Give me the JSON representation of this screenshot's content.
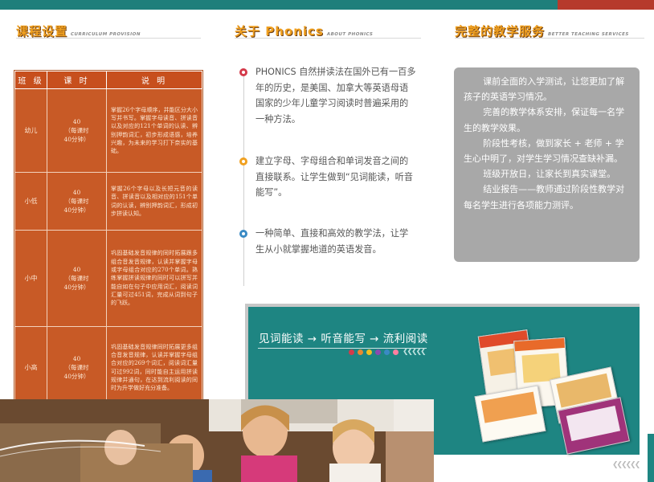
{
  "sections": {
    "curriculum": {
      "title": "课程设置",
      "subtitle": "CURRICULUM PROVISION"
    },
    "about": {
      "title": "关于 Phonics",
      "subtitle": "ABOUT PHONICS"
    },
    "service": {
      "title": "完整的教学服务",
      "subtitle": "BETTER TEACHING SERVICES"
    }
  },
  "table": {
    "headers": [
      "班 级",
      "课 时",
      "说 明"
    ],
    "rows": [
      {
        "grade": "幼儿",
        "hours": [
          "40",
          "（每课时",
          "40分钟）"
        ],
        "desc": "掌握26个字母顺序，并能区分大小写并书写。掌握字母读音、拼读音以及对应的121个单词的认读、辨别押韵词汇，初步形成语感，培养兴趣，为未来的学习打下奈实的基础。"
      },
      {
        "grade": "小低",
        "hours": [
          "40",
          "（每课时",
          "40分钟）"
        ],
        "desc": "掌握26个字母以及长短元音的读音、拼读音以及相对应的151个单词的认读，辨别押韵词汇，形成初步拼读认知。"
      },
      {
        "grade": "小中",
        "hours": [
          "40",
          "（每课时",
          "40分钟）"
        ],
        "desc": "巩固基础发音规律的同时拓展跟多组合音发音规律，认读并掌握字母或字母组合对应的270个单词。熟练掌握拼读规律的同时可以拼写并能自如在句子中应用词汇，阅读词汇量可过451词，完成从词到句子的飞跃。"
      },
      {
        "grade": "小高",
        "hours": [
          "40",
          "（每课时",
          "40分钟）"
        ],
        "desc": "巩固基础发音规律同时拓展更多组合音发音规律，认读并掌握字母组合对应的269个词汇，阅读词汇量可过992词，同时能自主运用拼读规律并通句，在达到流利阅读的同时为升学做好充分准备。"
      }
    ]
  },
  "about": {
    "points": [
      {
        "text": "PHONICS 自然拼读法在国外已有一百多年的历史，是美国、加拿大等英语母语国家的少年儿童学习阅读时普遍采用的一种方法。",
        "color": "#d43a4a"
      },
      {
        "text": "建立字母、字母组合和单词发音之间的直接联系。让学生做到“见词能读，听音能写”。",
        "color": "#f0a020"
      },
      {
        "text": "一种简单、直接和高效的教学法，让学生从小就掌握地道的英语发音。",
        "color": "#3a8ac4"
      }
    ]
  },
  "services": [
    "课前全面的入学测试，让您更加了解孩子的英语学习情况。",
    "完善的教学体系安排，保证每一名学生的教学效果。",
    "阶段性考核，做到家长 + 老师 + 学生心中明了，对学生学习情况查缺补漏。",
    "班级开放日，让家长到真实课堂。",
    "结业报告——教师通过阶段性教学对每名学生进行各项能力测评。"
  ],
  "banner": {
    "title": "见词能读 → 听音能写 → 流利阅读",
    "dot_colors": [
      "#d43a4a",
      "#e88a30",
      "#f0c020",
      "#8a4ab0",
      "#3a8ac4",
      "#ff7fa0"
    ]
  }
}
